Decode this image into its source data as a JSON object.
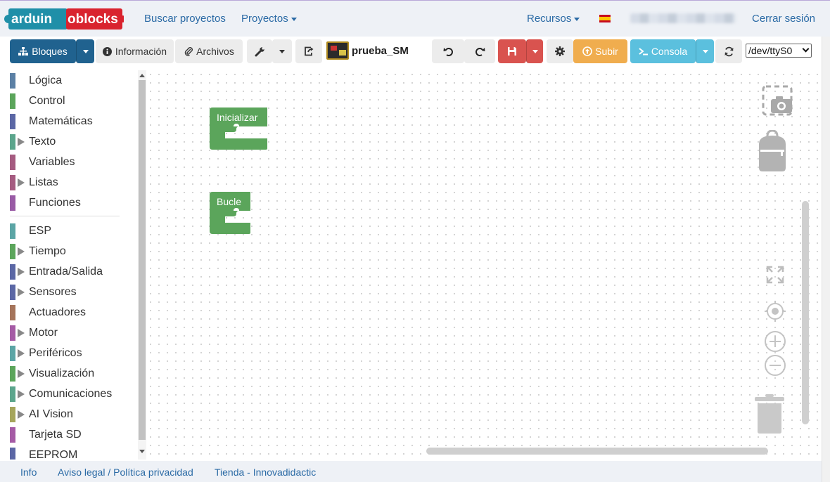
{
  "navbar": {
    "logo_left": "arduin",
    "logo_right": "oblocks",
    "search_projects": "Buscar proyectos",
    "projects": "Proyectos",
    "resources": "Recursos",
    "logout": "Cerrar sesión"
  },
  "toolbar": {
    "blocks": "Bloques",
    "info": "Información",
    "files": "Archivos",
    "project_name": "prueba_SM",
    "upload": "Subir",
    "console": "Consola",
    "port": "/dev/ttyS0"
  },
  "categories": [
    {
      "label": "Lógica",
      "color": "#5b80a5",
      "expandable": false
    },
    {
      "label": "Control",
      "color": "#5ba55b",
      "expandable": false
    },
    {
      "label": "Matemáticas",
      "color": "#5b67a5",
      "expandable": false
    },
    {
      "label": "Texto",
      "color": "#5ba58c",
      "expandable": true
    },
    {
      "label": "Variables",
      "color": "#a55b80",
      "expandable": false
    },
    {
      "label": "Listas",
      "color": "#a55b80",
      "expandable": true
    },
    {
      "label": "Funciones",
      "color": "#995ba5",
      "expandable": false
    },
    {
      "label": "ESP",
      "color": "#5ba5a5",
      "expandable": false
    },
    {
      "label": "Tiempo",
      "color": "#5ba55b",
      "expandable": true
    },
    {
      "label": "Entrada/Salida",
      "color": "#5b67a5",
      "expandable": true
    },
    {
      "label": "Sensores",
      "color": "#5b67a5",
      "expandable": true
    },
    {
      "label": "Actuadores",
      "color": "#a5745b",
      "expandable": false
    },
    {
      "label": "Motor",
      "color": "#a55ba5",
      "expandable": true
    },
    {
      "label": "Periféricos",
      "color": "#5ba5a5",
      "expandable": true
    },
    {
      "label": "Visualización",
      "color": "#5ba55b",
      "expandable": true
    },
    {
      "label": "Comunicaciones",
      "color": "#5ba58c",
      "expandable": true
    },
    {
      "label": "AI Vision",
      "color": "#a5a55b",
      "expandable": true
    },
    {
      "label": "Tarjeta SD",
      "color": "#a55ba5",
      "expandable": false
    },
    {
      "label": "EEPROM",
      "color": "#5b67a5",
      "expandable": false
    }
  ],
  "blocks": {
    "setup": "Inicializar",
    "loop": "Bucle",
    "color": "#5ba55b"
  },
  "footer": {
    "info": "Info",
    "legal": "Aviso legal / Política privacidad",
    "shop": "Tienda - Innovadidactic"
  }
}
